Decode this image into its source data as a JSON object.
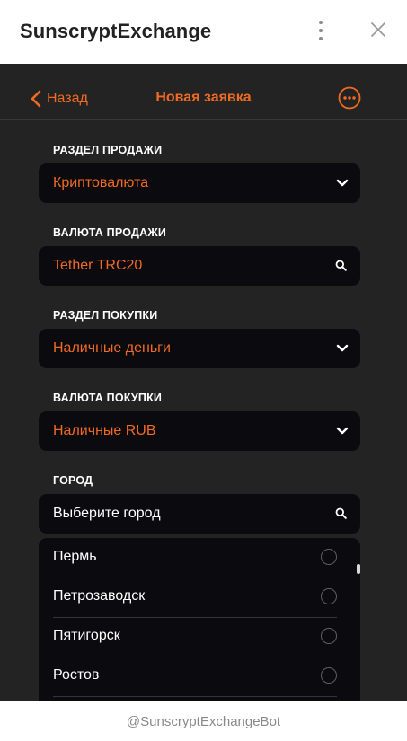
{
  "window": {
    "title": "SunscryptExchange",
    "menu_icon": "kebab-menu-icon",
    "close_icon": "close-icon"
  },
  "header": {
    "back_label": "Назад",
    "title": "Новая заявка",
    "more_icon": "more-options-icon"
  },
  "form": {
    "sell_section": {
      "label": "РАЗДЕЛ ПРОДАЖИ",
      "value": "Криптовалюта"
    },
    "sell_currency": {
      "label": "ВАЛЮТА ПРОДАЖИ",
      "value": "Tether TRC20"
    },
    "buy_section": {
      "label": "РАЗДЕЛ ПОКУПКИ",
      "value": "Наличные деньги"
    },
    "buy_currency": {
      "label": "ВАЛЮТА ПОКУПКИ",
      "value": "Наличные RUB"
    },
    "city": {
      "label": "ГОРОД",
      "placeholder": "Выберите город"
    }
  },
  "city_options": [
    "Пермь",
    "Петрозаводск",
    "Пятигорск",
    "Ростов"
  ],
  "footer": {
    "text": "@SunscryptExchangeBot"
  },
  "colors": {
    "accent": "#f06a23",
    "app_background": "#232323",
    "field_background": "#0b0b0f"
  }
}
